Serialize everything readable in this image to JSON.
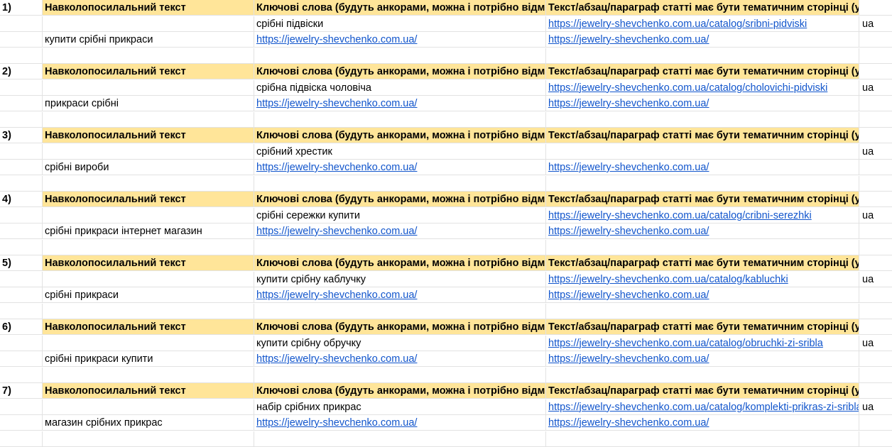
{
  "columns": {
    "anchor_text": "Навколопосилальний текст",
    "keywords": "Ключові слова (будуть анкорами, можна і потрібно відмінювати)",
    "paragraph": "Текст/абзац/параграф статті має бути тематичним сторінці (урл):"
  },
  "groups": [
    {
      "num": "1)",
      "keyword": "срібні підвіски",
      "keyword_url": "https://jewelry-shevchenko.com.ua/catalog/sribni-pidviski",
      "lang": "ua",
      "surround": "купити срібні прикраси",
      "surround_url1": "https://jewelry-shevchenko.com.ua/",
      "surround_url2": "https://jewelry-shevchenko.com.ua/"
    },
    {
      "num": "2)",
      "keyword": "срібна підвіска чоловіча",
      "keyword_url": "https://jewelry-shevchenko.com.ua/catalog/cholovichi-pidviski",
      "lang": "ua",
      "surround": "прикраси срібні",
      "surround_url1": "https://jewelry-shevchenko.com.ua/",
      "surround_url2": "https://jewelry-shevchenko.com.ua/"
    },
    {
      "num": "3)",
      "keyword": "срібний хрестик",
      "keyword_url": "",
      "lang": "ua",
      "surround": "срібні вироби",
      "surround_url1": "https://jewelry-shevchenko.com.ua/",
      "surround_url2": "https://jewelry-shevchenko.com.ua/"
    },
    {
      "num": "4)",
      "keyword": "срібні сережки купити",
      "keyword_url": "https://jewelry-shevchenko.com.ua/catalog/cribni-serezhki",
      "lang": "ua",
      "surround": "срібні прикраси інтернет магазин",
      "surround_url1": "https://jewelry-shevchenko.com.ua/",
      "surround_url2": "https://jewelry-shevchenko.com.ua/"
    },
    {
      "num": "5)",
      "keyword": "купити срібну каблучку",
      "keyword_url": "https://jewelry-shevchenko.com.ua/catalog/kabluchki",
      "lang": "ua",
      "surround": "срібні прикраси",
      "surround_url1": "https://jewelry-shevchenko.com.ua/",
      "surround_url2": "https://jewelry-shevchenko.com.ua/"
    },
    {
      "num": "6)",
      "keyword": "купити срібну обручку",
      "keyword_url": "https://jewelry-shevchenko.com.ua/catalog/obruchki-zi-sribla",
      "lang": "ua",
      "surround": "срібні прикраси купити",
      "surround_url1": "https://jewelry-shevchenko.com.ua/",
      "surround_url2": "https://jewelry-shevchenko.com.ua/"
    },
    {
      "num": "7)",
      "keyword": "набір срібних прикрас",
      "keyword_url": "https://jewelry-shevchenko.com.ua/catalog/komplekti-prikras-zi-sribla",
      "lang": "ua",
      "surround": "магазин срібних прикрас",
      "surround_url1": "https://jewelry-shevchenko.com.ua/",
      "surround_url2": "https://jewelry-shevchenko.com.ua/"
    }
  ]
}
